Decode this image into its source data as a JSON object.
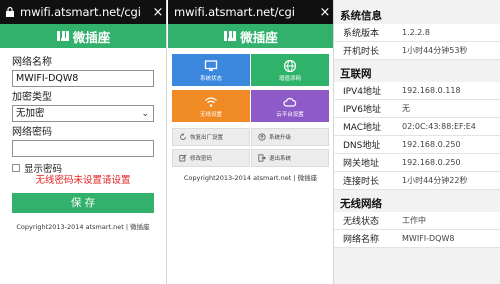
{
  "browser": {
    "url": "mwifi.atsmart.net/cgi",
    "close": "×"
  },
  "brand": {
    "name": "微插座"
  },
  "config_form": {
    "ssid_label": "网络名称",
    "ssid_value": "MWIFI-DQW8",
    "encryption_label": "加密类型",
    "encryption_value": "无加密",
    "password_label": "网络密码",
    "password_value": "",
    "show_password_label": "显示密码",
    "warning": "无线密码未设置请设置",
    "save_label": "保 存",
    "copyright": "Copyright2013-2014 atsmart.net | 微插座"
  },
  "dashboard": {
    "tiles": [
      {
        "label": "系统状态",
        "color": "#3b87dd",
        "icon": "monitor-icon"
      },
      {
        "label": "增值添网",
        "color": "#2fb36a",
        "icon": "globe-icon"
      },
      {
        "label": "无线设置",
        "color": "#f08a24",
        "icon": "wifi-icon"
      },
      {
        "label": "云平台设置",
        "color": "#8e5ac8",
        "icon": "cloud-icon"
      }
    ],
    "gray_tiles": [
      {
        "label": "恢复出厂设置",
        "icon": "reset-icon"
      },
      {
        "label": "系统升级",
        "icon": "upgrade-icon"
      },
      {
        "label": "修改密码",
        "icon": "edit-icon"
      },
      {
        "label": "退出系统",
        "icon": "logout-icon"
      }
    ],
    "copyright": "Copyright2013-2014 atsmart.net | 微插座"
  },
  "status": {
    "system_title": "系统信息",
    "system": [
      {
        "key": "系统版本",
        "value": "1.2.2.8"
      },
      {
        "key": "开机时长",
        "value": "1小时44分钟53秒"
      }
    ],
    "internet_title": "互联网",
    "internet": [
      {
        "key": "IPV4地址",
        "value": "192.168.0.118"
      },
      {
        "key": "IPV6地址",
        "value": "无"
      },
      {
        "key": "MAC地址",
        "value": "02:0C:43:88:EF:E4"
      },
      {
        "key": "DNS地址",
        "value": "192.168.0.250"
      },
      {
        "key": "网关地址",
        "value": "192.168.0.250"
      },
      {
        "key": "连接时长",
        "value": "1小时44分钟22秒"
      }
    ],
    "wireless_title": "无线网络",
    "wireless": [
      {
        "key": "无线状态",
        "value": "工作中"
      },
      {
        "key": "网络名称",
        "value": "MWIFI-DQW8"
      }
    ]
  },
  "colors": {
    "accent": "#32b16c",
    "warning": "#e52222"
  }
}
